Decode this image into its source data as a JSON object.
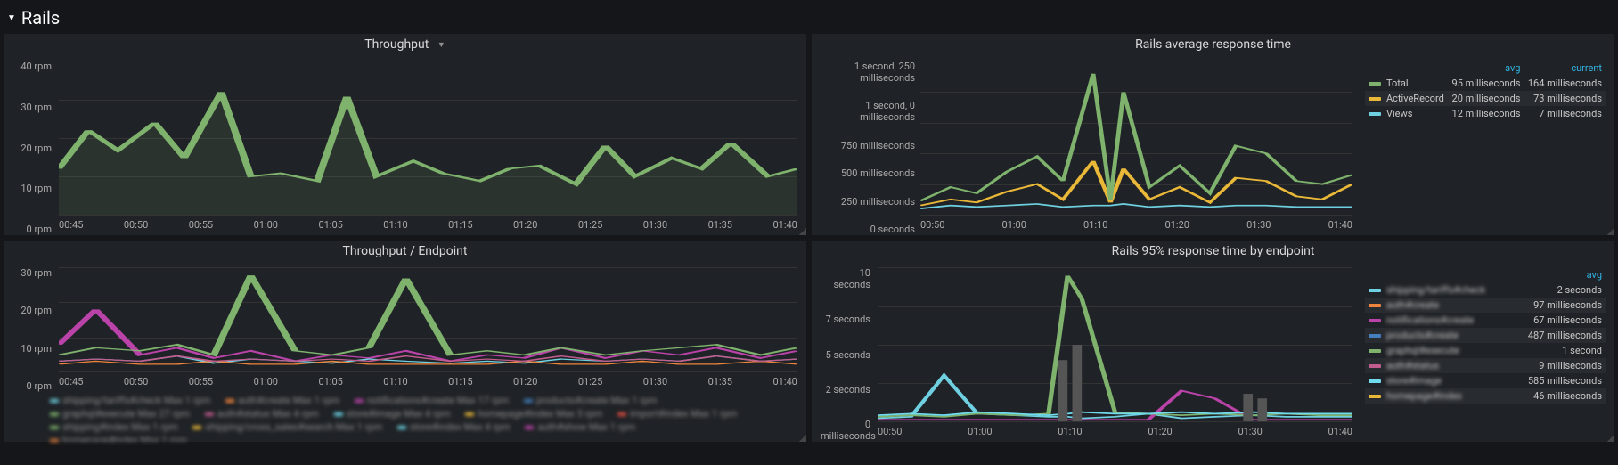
{
  "row": {
    "title": "Rails"
  },
  "panels": {
    "throughput": {
      "title": "Throughput",
      "ylabels": [
        "40 rpm",
        "30 rpm",
        "20 rpm",
        "10 rpm",
        "0 rpm"
      ],
      "xlabels": [
        "00:45",
        "00:50",
        "00:55",
        "01:00",
        "01:05",
        "01:10",
        "01:15",
        "01:20",
        "01:25",
        "01:30",
        "01:35",
        "01:40"
      ]
    },
    "avg_rt": {
      "title": "Rails average response time",
      "ylabels": [
        "1 second, 250 milliseconds",
        "1 second, 0 milliseconds",
        "750 milliseconds",
        "500 milliseconds",
        "250 milliseconds",
        "0 seconds"
      ],
      "xlabels": [
        "00:50",
        "01:00",
        "01:10",
        "01:20",
        "01:30",
        "01:40"
      ],
      "legend_headers": [
        "",
        "avg",
        "current"
      ],
      "legend_rows": [
        {
          "color": "#7EB26D",
          "name": "Total",
          "avg": "95 milliseconds",
          "current": "164 milliseconds"
        },
        {
          "color": "#EAB839",
          "name": "ActiveRecord",
          "avg": "20 milliseconds",
          "current": "73 milliseconds"
        },
        {
          "color": "#6ED0E0",
          "name": "Views",
          "avg": "12 milliseconds",
          "current": "7 milliseconds"
        }
      ]
    },
    "throughput_ep": {
      "title": "Throughput / Endpoint",
      "ylabels": [
        "30 rpm",
        "20 rpm",
        "10 rpm",
        "0 rpm"
      ],
      "xlabels": [
        "00:45",
        "00:50",
        "00:55",
        "01:00",
        "01:05",
        "01:10",
        "01:15",
        "01:20",
        "01:25",
        "01:30",
        "01:35",
        "01:40"
      ]
    },
    "p95_rt": {
      "title": "Rails 95% response time by endpoint",
      "ylabels": [
        "10 seconds",
        "7 seconds",
        "5 seconds",
        "2 seconds",
        "0 milliseconds"
      ],
      "xlabels": [
        "00:50",
        "01:00",
        "01:10",
        "01:20",
        "01:30",
        "01:40"
      ],
      "legend_headers": [
        "",
        "avg"
      ],
      "legend_rows": [
        {
          "color": "#6ED0E0",
          "name": "shipping/tariffs#check",
          "avg": "2 seconds"
        },
        {
          "color": "#EF843C",
          "name": "auth#create",
          "avg": "97 milliseconds"
        },
        {
          "color": "#BA43A9",
          "name": "notifications#create",
          "avg": "67 milliseconds"
        },
        {
          "color": "#447EBC",
          "name": "products#create",
          "avg": "487 milliseconds"
        },
        {
          "color": "#7EB26D",
          "name": "graphql#execute",
          "avg": "1 second"
        },
        {
          "color": "#C15C8E",
          "name": "auth#status",
          "avg": "9 milliseconds"
        },
        {
          "color": "#70DBED",
          "name": "store#image",
          "avg": "585 milliseconds"
        },
        {
          "color": "#EAB839",
          "name": "homepage#index",
          "avg": "46 milliseconds"
        }
      ]
    }
  },
  "chart_data": [
    {
      "type": "line",
      "title": "Throughput",
      "xlabel": "",
      "ylabel": "rpm",
      "ylim": [
        0,
        40
      ],
      "x": [
        "00:42",
        "00:45",
        "00:47",
        "00:50",
        "00:52",
        "00:55",
        "00:57",
        "01:00",
        "01:02",
        "01:05",
        "01:07",
        "01:10",
        "01:12",
        "01:15",
        "01:17",
        "01:20",
        "01:22",
        "01:25",
        "01:27",
        "01:30",
        "01:32",
        "01:35",
        "01:37",
        "01:40"
      ],
      "series": [
        {
          "name": "Total",
          "color": "#7EB26D",
          "values": [
            12,
            22,
            17,
            24,
            15,
            32,
            10,
            11,
            9,
            31,
            10,
            14,
            11,
            9,
            12,
            13,
            8,
            18,
            10,
            15,
            12,
            19,
            10,
            12
          ]
        }
      ]
    },
    {
      "type": "line",
      "title": "Rails average response time",
      "xlabel": "",
      "ylabel": "ms",
      "ylim": [
        0,
        1250
      ],
      "x": [
        "00:48",
        "00:52",
        "00:56",
        "01:00",
        "01:04",
        "01:08",
        "01:10",
        "01:12",
        "01:14",
        "01:18",
        "01:22",
        "01:26",
        "01:30",
        "01:34",
        "01:38",
        "01:40"
      ],
      "series": [
        {
          "name": "Total",
          "color": "#7EB26D",
          "values": [
            60,
            120,
            90,
            200,
            300,
            150,
            1150,
            80,
            1000,
            110,
            250,
            90,
            350,
            300,
            150,
            164
          ]
        },
        {
          "name": "ActiveRecord",
          "color": "#EAB839",
          "values": [
            15,
            30,
            20,
            50,
            70,
            40,
            230,
            25,
            200,
            30,
            60,
            25,
            90,
            80,
            40,
            73
          ]
        },
        {
          "name": "Views",
          "color": "#6ED0E0",
          "values": [
            5,
            15,
            10,
            12,
            18,
            10,
            20,
            8,
            18,
            9,
            10,
            8,
            14,
            12,
            8,
            7
          ]
        }
      ]
    },
    {
      "type": "line",
      "title": "Throughput / Endpoint",
      "xlabel": "",
      "ylabel": "rpm",
      "ylim": [
        0,
        30
      ],
      "x": [
        "00:42",
        "00:45",
        "00:48",
        "00:51",
        "00:54",
        "00:57",
        "01:00",
        "01:03",
        "01:06",
        "01:09",
        "01:12",
        "01:15",
        "01:18",
        "01:21",
        "01:24",
        "01:27",
        "01:30",
        "01:33",
        "01:36",
        "01:39"
      ],
      "series": [
        {
          "name": "shipping/tariffs#check",
          "color": "#6ED0E0",
          "values": [
            3,
            4,
            3,
            5,
            2,
            4,
            3,
            2,
            4,
            3,
            2,
            3,
            2,
            4,
            3,
            4,
            3,
            5,
            3,
            4
          ]
        },
        {
          "name": "auth#create",
          "color": "#EF843C",
          "values": [
            2,
            3,
            2,
            2,
            3,
            2,
            2,
            3,
            2,
            2,
            2,
            2,
            3,
            2,
            2,
            3,
            2,
            2,
            3,
            2
          ]
        },
        {
          "name": "notifications#create",
          "color": "#BA43A9",
          "values": [
            8,
            18,
            5,
            7,
            4,
            6,
            3,
            5,
            4,
            6,
            3,
            5,
            4,
            7,
            4,
            6,
            5,
            7,
            4,
            6
          ]
        },
        {
          "name": "products#create",
          "color": "#447EBC",
          "values": [
            2,
            2,
            3,
            2,
            2,
            2,
            3,
            2,
            2,
            2,
            2,
            3,
            2,
            2,
            3,
            2,
            2,
            2,
            3,
            2
          ]
        },
        {
          "name": "graphql#execute",
          "color": "#7EB26D",
          "values": [
            5,
            7,
            6,
            8,
            5,
            28,
            6,
            5,
            7,
            27,
            5,
            6,
            5,
            7,
            5,
            6,
            7,
            8,
            5,
            7
          ]
        },
        {
          "name": "auth#status",
          "color": "#C15C8E",
          "values": [
            3,
            4,
            3,
            5,
            3,
            4,
            3,
            4,
            3,
            5,
            3,
            4,
            3,
            5,
            3,
            4,
            3,
            5,
            3,
            4
          ]
        }
      ]
    },
    {
      "type": "line",
      "title": "Rails 95% response time by endpoint",
      "xlabel": "",
      "ylabel": "seconds",
      "ylim": [
        0,
        10
      ],
      "x": [
        "00:48",
        "00:52",
        "00:56",
        "01:00",
        "01:04",
        "01:08",
        "01:10",
        "01:12",
        "01:16",
        "01:20",
        "01:24",
        "01:28",
        "01:32",
        "01:36",
        "01:40"
      ],
      "series": [
        {
          "name": "shipping/tariffs#check",
          "color": "#6ED0E0",
          "values": [
            0.2,
            0.3,
            3.0,
            0.5,
            0.4,
            0.3,
            0.3,
            0.2,
            0.3,
            0.5,
            0.2,
            0.3,
            0.4,
            0.3,
            0.3
          ]
        },
        {
          "name": "notifications#create",
          "color": "#BA43A9",
          "values": [
            0.05,
            0.07,
            0.05,
            0.06,
            0.05,
            0.06,
            0.05,
            0.06,
            0.05,
            0.06,
            2.0,
            1.5,
            0.06,
            0.05,
            0.06
          ]
        },
        {
          "name": "graphql#execute",
          "color": "#7EB26D",
          "values": [
            0.3,
            0.4,
            0.3,
            0.5,
            0.4,
            0.5,
            9.5,
            8.0,
            0.6,
            0.5,
            0.4,
            0.5,
            0.4,
            0.5,
            0.4
          ]
        },
        {
          "name": "store#image",
          "color": "#70DBED",
          "values": [
            0.4,
            0.5,
            0.4,
            0.6,
            0.5,
            0.4,
            0.5,
            0.6,
            0.5,
            0.5,
            0.6,
            0.5,
            0.6,
            0.5,
            0.5
          ]
        }
      ]
    }
  ]
}
